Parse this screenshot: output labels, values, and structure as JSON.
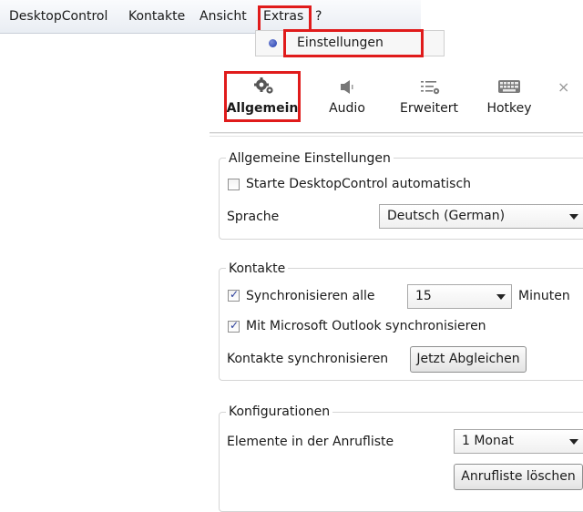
{
  "menubar": {
    "items": [
      "DesktopControl",
      "Kontakte",
      "Ansicht",
      "Extras",
      "?"
    ]
  },
  "dropdown": {
    "item_label": "Einstellungen"
  },
  "tabs": [
    {
      "label": "Allgemein",
      "icon": "gears-icon",
      "active": true
    },
    {
      "label": "Audio",
      "icon": "speaker-icon",
      "active": false
    },
    {
      "label": "Erweitert",
      "icon": "advanced-settings-icon",
      "active": false
    },
    {
      "label": "Hotkey",
      "icon": "keyboard-icon",
      "active": false
    }
  ],
  "close_glyph": "×",
  "general": {
    "title": "Allgemeine Einstellungen",
    "autostart_label": "Starte DesktopControl automatisch",
    "autostart_checked": false,
    "language_label": "Sprache",
    "language_value": "Deutsch (German)"
  },
  "contacts": {
    "title": "Kontakte",
    "sync_label": "Synchronisieren alle",
    "sync_checked": true,
    "sync_interval": "15",
    "sync_unit": "Minuten",
    "outlook_label": "Mit Microsoft Outlook synchronisieren",
    "outlook_checked": true,
    "sync_contacts_label": "Kontakte synchronisieren",
    "sync_now_button": "Jetzt Abgleichen"
  },
  "configs": {
    "title": "Konfigurationen",
    "calllist_label": "Elemente in der Anrufliste",
    "calllist_value": "1 Monat",
    "clear_button": "Anrufliste löschen"
  },
  "colors": {
    "highlight": "#e01b1b",
    "radio": "#1f3bb0"
  }
}
